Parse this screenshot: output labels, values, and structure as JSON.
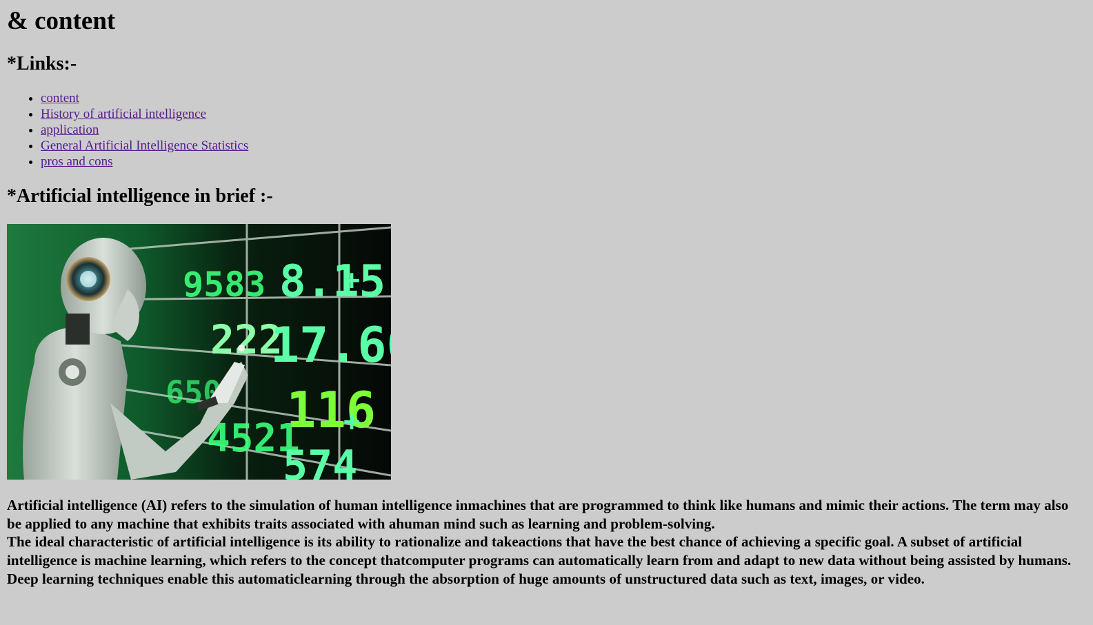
{
  "page": {
    "title": "& content"
  },
  "links_section": {
    "heading": "*Links:-",
    "items": [
      {
        "label": "content"
      },
      {
        "label": "History of artificial intelligence"
      },
      {
        "label": "application"
      },
      {
        "label": "General Artificial Intelligence Statistics"
      },
      {
        "label": "pros and cons"
      }
    ]
  },
  "brief_section": {
    "heading": "*Artificial intelligence in brief :-",
    "image": {
      "icon": "ai-robot-stock-board-image",
      "board_numbers": [
        "9583",
        "8.15",
        "+",
        "222",
        "17.60",
        "116",
        "+",
        "4521",
        "574",
        "650"
      ],
      "colors": {
        "green_bright": "#3cff6a",
        "green_dark": "#0b3d1e",
        "robot": "#cfd6cf",
        "board_bg": "#070b08"
      }
    },
    "paragraphs": [
      "Artificial intelligence (AI) refers to the simulation of human intelligence inmachines that are programmed to think like humans and mimic their actions. The term may also be applied to any machine that exhibits traits associated with ahuman mind such as learning and problem-solving.",
      "The ideal characteristic of artificial intelligence is its ability to rationalize and takeactions that have the best chance of achieving a specific goal. A subset of artificial intelligence is machine learning, which refers to the concept thatcomputer programs can automatically learn from and adapt to new data without being assisted by humans. Deep learning techniques enable this automaticlearning through the absorption of huge amounts of unstructured data such as text, images, or video."
    ]
  }
}
